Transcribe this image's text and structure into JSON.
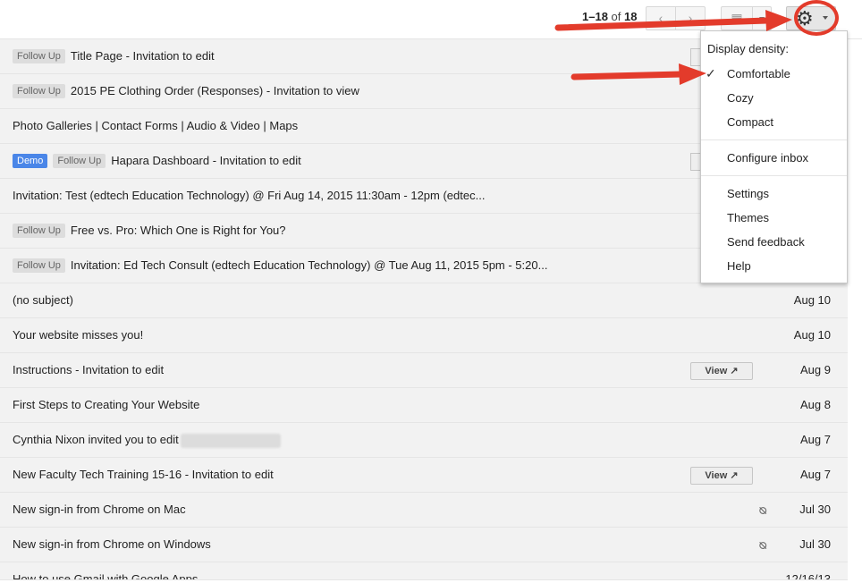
{
  "toolbar": {
    "pagination_range": "1–18",
    "pagination_of": "of",
    "pagination_total": "18",
    "prev_glyph": "‹",
    "next_glyph": "›",
    "layout_glyph": "▦",
    "gear_glyph": "⚙"
  },
  "emails": [
    {
      "labels": [
        {
          "text": "Follow Up",
          "type": "follow"
        }
      ],
      "subject": "Title Page - Invitation to edit",
      "date": "",
      "ghost": true
    },
    {
      "labels": [
        {
          "text": "Follow Up",
          "type": "follow"
        }
      ],
      "subject": "2015 PE Clothing Order (Responses) - Invitation to view",
      "date": "",
      "ghost": false
    },
    {
      "labels": [],
      "subject": "Photo Galleries | Contact Forms | Audio & Video | Maps",
      "date": "",
      "ghost": false
    },
    {
      "labels": [
        {
          "text": "Demo",
          "type": "demo"
        },
        {
          "text": "Follow Up",
          "type": "follow"
        }
      ],
      "subject": "Hapara Dashboard - Invitation to edit",
      "date": "",
      "ghost": true
    },
    {
      "labels": [],
      "subject": "Invitation: Test (edtech Education Technology) @ Fri Aug 14, 2015 11:30am - 12pm (edtec...",
      "date": "",
      "ghost": false
    },
    {
      "labels": [
        {
          "text": "Follow Up",
          "type": "follow"
        }
      ],
      "subject": "Free vs. Pro: Which One is Right for You?",
      "date": "",
      "ghost": false
    },
    {
      "labels": [
        {
          "text": "Follow Up",
          "type": "follow"
        }
      ],
      "subject": "Invitation: Ed Tech Consult (edtech Education Technology) @ Tue Aug 11, 2015 5pm - 5:20...",
      "date": "",
      "ghost": false
    },
    {
      "labels": [],
      "subject": "(no subject)",
      "date": "Aug 10"
    },
    {
      "labels": [],
      "subject": "Your website misses you!",
      "date": "Aug 10"
    },
    {
      "labels": [],
      "subject": "Instructions - Invitation to edit",
      "date": "Aug 9",
      "view": "View ↗"
    },
    {
      "labels": [],
      "subject": "First Steps to Creating Your Website",
      "date": "Aug 8"
    },
    {
      "labels": [],
      "subject": "Cynthia Nixon invited you to edit",
      "date": "Aug 7",
      "blurred": true
    },
    {
      "labels": [],
      "subject": "New Faculty Tech Training 15-16 - Invitation to edit",
      "date": "Aug 7",
      "view": "View ↗"
    },
    {
      "labels": [],
      "subject": "New sign-in from Chrome on Mac",
      "date": "Jul 30",
      "attachment": "paperclip-icon"
    },
    {
      "labels": [],
      "subject": "New sign-in from Chrome on Windows",
      "date": "Jul 30",
      "attachment": "paperclip-icon"
    },
    {
      "labels": [],
      "subject": "How to use Gmail with Google Apps",
      "date": "12/16/13"
    }
  ],
  "menu": {
    "heading": "Display density:",
    "check_glyph": "✓",
    "density": [
      "Comfortable",
      "Cozy",
      "Compact"
    ],
    "selected_density": "Comfortable",
    "configure": "Configure inbox",
    "items": [
      "Settings",
      "Themes",
      "Send feedback",
      "Help"
    ]
  },
  "colors": {
    "annotation_red": "#e33b2b",
    "demo_label": "#4a86e8",
    "follow_label": "#dddddd"
  }
}
